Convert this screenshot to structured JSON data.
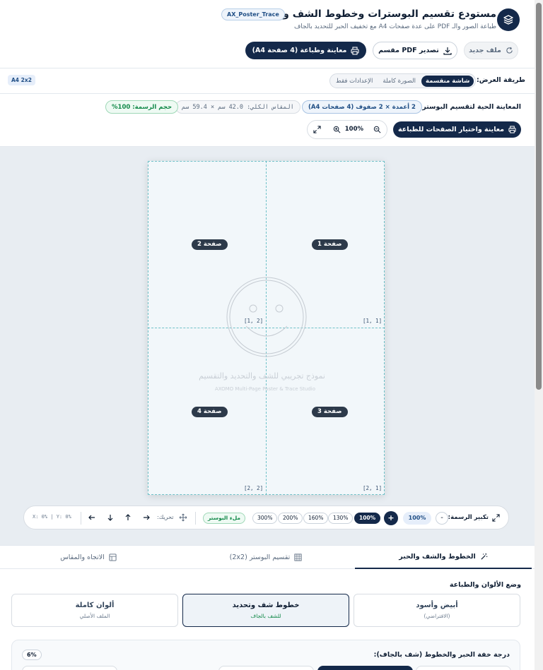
{
  "header": {
    "title": "مستودع تقسيم البوسترات وخطوط الشف والتحديد",
    "subtitle": "طباعة الصور والـ PDF على عدة صفحات A4 مع تخفيف الحبر للتحديد بالجاف",
    "badge": "AX_Poster_Trace",
    "print_button": "معاينة وطباعة (4 صفحة A4)",
    "export_button": "تصدير PDF مقسم",
    "new_button": "ملف جديد"
  },
  "view_mode": {
    "label": "طريقة العرض:",
    "options": [
      "شاشة منقسمة",
      "الصورة كاملة",
      "الإعدادات فقط"
    ],
    "selected": "شاشة منقسمة",
    "grid_badge": "A4 2x2"
  },
  "preview": {
    "title": "المعاينة الحية لتقسيم البوستر:",
    "grid_pill": "2 أعمدة × 2 صفوف (4 صفحات A4)",
    "size_pill": "المقاس الكلي: 42.0 سم × 59.4 سم",
    "scale_pill": "حجم الرسمة: 100%",
    "print_select_button": "معاينة واختيار الصفحات للطباعة",
    "zoom_value": "100%"
  },
  "sheet": {
    "pages": [
      {
        "label": "صفحة 1",
        "coord": "[1, 1]"
      },
      {
        "label": "صفحة 2",
        "coord": "[1, 2]"
      },
      {
        "label": "صفحة 3",
        "coord": "[2, 1]"
      },
      {
        "label": "صفحة 4",
        "coord": "[2, 2]"
      }
    ],
    "watermark_main": "نموذج تجريبي للشف والتحديد والتقسيم",
    "watermark_sub": "AXOMO Multi-Page Poster & Trace Studio"
  },
  "zoom_bar": {
    "label": "تكبير الرسمة:",
    "minus": "-",
    "value": "100%",
    "plus": "+",
    "presets": [
      "100%",
      "130%",
      "160%",
      "200%",
      "300%"
    ],
    "active_preset": "100%",
    "fill_button": "ملء البوستر",
    "move_label": "تحريك:",
    "position": "X: 0% | Y: 0%"
  },
  "tabs": [
    "الخطوط والشف والحبر",
    "تقسيم البوستر (2x2)",
    "الاتجاه والمقاس"
  ],
  "active_tab": "الخطوط والشف والحبر",
  "color_mode": {
    "heading": "وضع الألوان والطباعة",
    "options": [
      {
        "title": "أبيض وأسود",
        "sub": "(الافتراضي)"
      },
      {
        "title": "خطوط شف وتحديد",
        "sub": "للشف بالجاف"
      },
      {
        "title": "ألوان كاملة",
        "sub": "الملف الأصلي"
      }
    ],
    "selected": "خطوط شف وتحديد"
  },
  "ink": {
    "heading": "درجة خفة الحبر والخطوط (شف بالجاف):",
    "value": "6%"
  },
  "colors": {
    "primary": "#14294a",
    "accent_teal": "#6fc1c8",
    "success": "#138a4a"
  }
}
